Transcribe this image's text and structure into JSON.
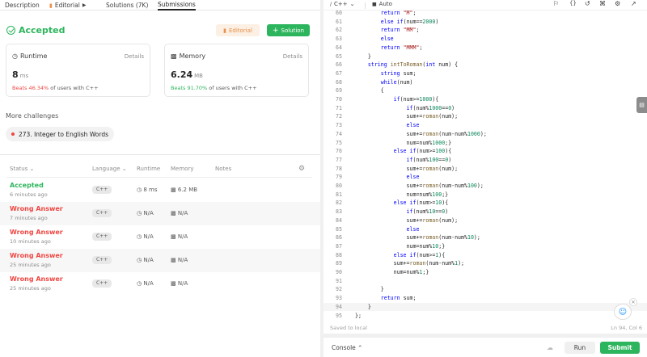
{
  "tabs": [
    {
      "label": "Description"
    },
    {
      "label": "Editorial"
    },
    {
      "label": "Solutions (7K)"
    },
    {
      "label": "Submissions"
    }
  ],
  "result": {
    "status": "Accepted",
    "editorial_button": "Editorial",
    "solution_button": "Solution"
  },
  "runtime": {
    "label": "Runtime",
    "details": "Details",
    "value": "8",
    "unit": "ms",
    "beats_pct": "Beats 46.34%",
    "beats_rest": " of users with C++"
  },
  "memory": {
    "label": "Memory",
    "details": "Details",
    "value": "6.24",
    "unit": "MB",
    "beats_pct": "Beats 91.70%",
    "beats_rest": " of users with C++"
  },
  "more_challenges": {
    "heading": "More challenges",
    "item": "273. Integer to English Words"
  },
  "table": {
    "headers": {
      "status": "Status",
      "language": "Language",
      "runtime": "Runtime",
      "memory": "Memory",
      "notes": "Notes"
    },
    "rows": [
      {
        "status": "Accepted",
        "time": "6 minutes ago",
        "lang": "C++",
        "runtime": "8 ms",
        "memory": "6.2 MB"
      },
      {
        "status": "Wrong Answer",
        "time": "7 minutes ago",
        "lang": "C++",
        "runtime": "N/A",
        "memory": "N/A"
      },
      {
        "status": "Wrong Answer",
        "time": "10 minutes ago",
        "lang": "C++",
        "runtime": "N/A",
        "memory": "N/A"
      },
      {
        "status": "Wrong Answer",
        "time": "25 minutes ago",
        "lang": "C++",
        "runtime": "N/A",
        "memory": "N/A"
      },
      {
        "status": "Wrong Answer",
        "time": "25 minutes ago",
        "lang": "C++",
        "runtime": "N/A",
        "memory": "N/A"
      }
    ]
  },
  "editor": {
    "language": "C++",
    "mode": "Auto",
    "saved": "Saved to local",
    "cursor": "Ln 94, Col 6",
    "lines": [
      {
        "n": "60",
        "code": "        return \"M\";"
      },
      {
        "n": "61",
        "code": "        else if(num==2000)"
      },
      {
        "n": "62",
        "code": "        return \"MM\";"
      },
      {
        "n": "63",
        "code": "        else"
      },
      {
        "n": "64",
        "code": "        return \"MMM\";"
      },
      {
        "n": "65",
        "code": "    }"
      },
      {
        "n": "66",
        "code": "    string intToRoman(int num) {"
      },
      {
        "n": "67",
        "code": "        string sum;"
      },
      {
        "n": "68",
        "code": "        while(num)"
      },
      {
        "n": "69",
        "code": "        {"
      },
      {
        "n": "70",
        "code": "            if(num>=1000){"
      },
      {
        "n": "71",
        "code": "                if(num%1000==0)"
      },
      {
        "n": "72",
        "code": "                sum+=roman(num);"
      },
      {
        "n": "73",
        "code": "                else"
      },
      {
        "n": "74",
        "code": "                sum+=roman(num-num%1000);"
      },
      {
        "n": "75",
        "code": "                num=num%1000;}"
      },
      {
        "n": "76",
        "code": "            else if(num>=100){"
      },
      {
        "n": "77",
        "code": "                if(num%100==0)"
      },
      {
        "n": "78",
        "code": "                sum+=roman(num);"
      },
      {
        "n": "79",
        "code": "                else"
      },
      {
        "n": "80",
        "code": "                sum+=roman(num-num%100);"
      },
      {
        "n": "81",
        "code": "                num=num%100;}"
      },
      {
        "n": "82",
        "code": "            else if(num>=10){"
      },
      {
        "n": "83",
        "code": "                if(num%10==0)"
      },
      {
        "n": "84",
        "code": "                sum+=roman(num);"
      },
      {
        "n": "85",
        "code": "                else"
      },
      {
        "n": "86",
        "code": "                sum+=roman(num-num%10);"
      },
      {
        "n": "87",
        "code": "                num=num%10;}"
      },
      {
        "n": "88",
        "code": "            else if(num>=1){"
      },
      {
        "n": "89",
        "code": "            sum+=roman(num-num%1);"
      },
      {
        "n": "90",
        "code": "            num=num%1;}"
      },
      {
        "n": "91",
        "code": ""
      },
      {
        "n": "92",
        "code": "        }"
      },
      {
        "n": "93",
        "code": "        return sum;"
      },
      {
        "n": "94",
        "code": "    }"
      },
      {
        "n": "95",
        "code": "};"
      }
    ]
  },
  "bottom": {
    "console": "Console",
    "run": "Run",
    "submit": "Submit"
  },
  "colors": {
    "accent_green": "#2db55d",
    "error_red": "#ef4743",
    "editorial_orange": "#e8914c"
  }
}
